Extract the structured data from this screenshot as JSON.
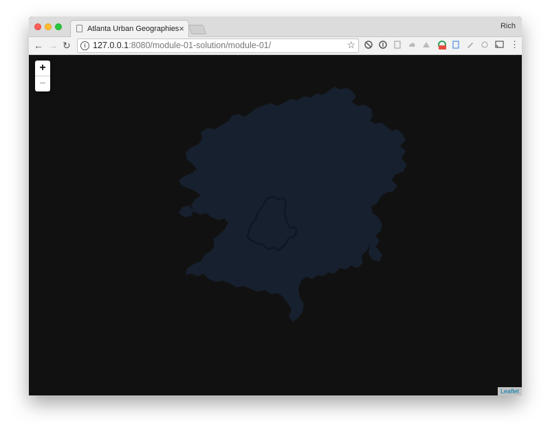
{
  "browser": {
    "tab_title": "Atlanta Urban Geographies",
    "tab_close": "×",
    "profile_name": "Rich",
    "url_host": "127.0.0.1",
    "url_rest": ":8080/module-01-solution/module-01/"
  },
  "map": {
    "zoom_in_label": "+",
    "zoom_out_label": "−",
    "attribution": "Leaflet",
    "background_color": "#111111",
    "urban_area_color": "#17202e",
    "city_outline_color": "#0d1726"
  },
  "icons": {
    "back": "←",
    "forward": "→",
    "reload": "↻",
    "star": "☆",
    "menu": "⋮",
    "info": "i"
  }
}
